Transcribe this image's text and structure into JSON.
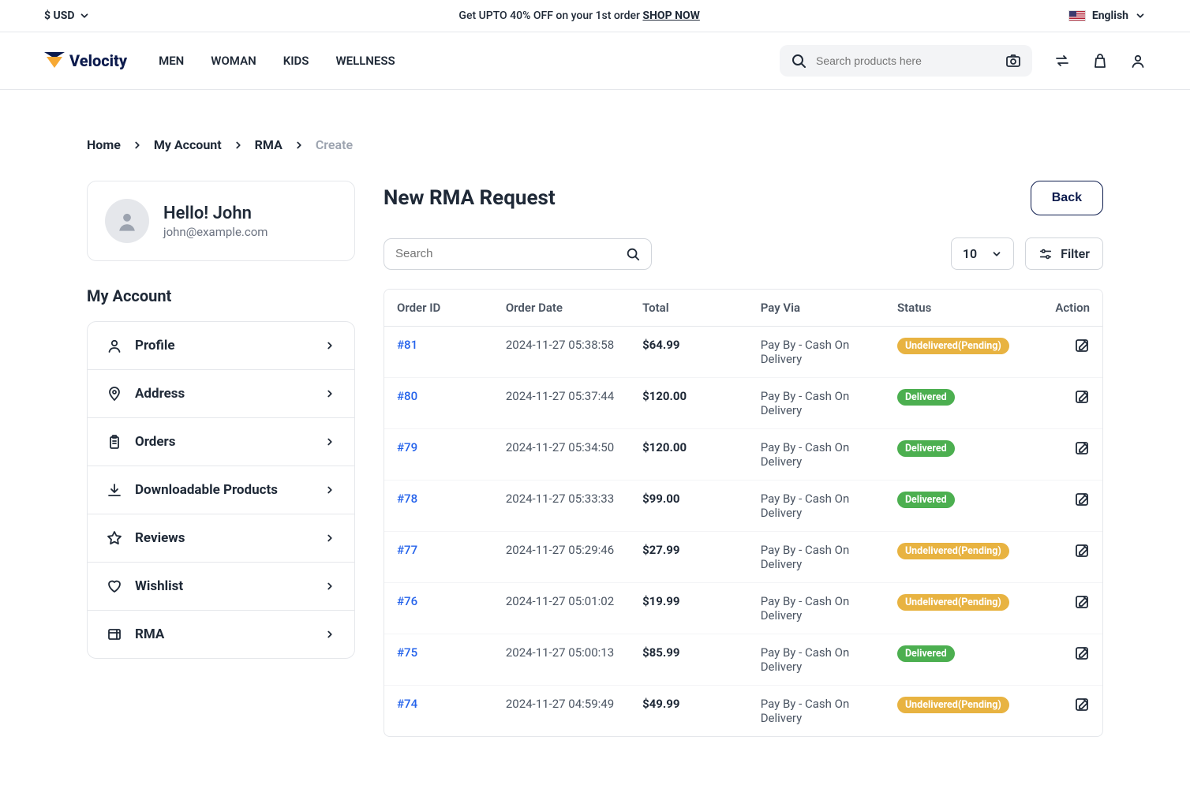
{
  "topbar": {
    "currency": "$ USD",
    "promo_prefix": "Get UPTO 40% OFF on your 1st order ",
    "promo_link": "SHOP NOW",
    "language": "English"
  },
  "header": {
    "logo_text": "Velocity",
    "nav": [
      "MEN",
      "WOMAN",
      "KIDS",
      "WELLNESS"
    ],
    "search_placeholder": "Search products here"
  },
  "breadcrumb": {
    "items": [
      "Home",
      "My Account",
      "RMA"
    ],
    "current": "Create"
  },
  "user": {
    "greeting": "Hello! John",
    "email": "john@example.com"
  },
  "sidebar": {
    "title": "My Account",
    "items": [
      {
        "label": "Profile",
        "icon": "user"
      },
      {
        "label": "Address",
        "icon": "pin"
      },
      {
        "label": "Orders",
        "icon": "clipboard"
      },
      {
        "label": "Downloadable Products",
        "icon": "download"
      },
      {
        "label": "Reviews",
        "icon": "star"
      },
      {
        "label": "Wishlist",
        "icon": "heart"
      },
      {
        "label": "RMA",
        "icon": "rma"
      }
    ]
  },
  "main": {
    "title": "New RMA Request",
    "back_label": "Back",
    "search_placeholder": "Search",
    "per_page": "10",
    "filter_label": "Filter",
    "columns": {
      "order_id": "Order ID",
      "order_date": "Order Date",
      "total": "Total",
      "pay_via": "Pay Via",
      "status": "Status",
      "action": "Action"
    },
    "rows": [
      {
        "order_id": "#81",
        "order_date": "2024-11-27 05:38:58",
        "total": "$64.99",
        "pay_via": "Pay By - Cash On Delivery",
        "status": "Undelivered(Pending)",
        "status_color": "yellow"
      },
      {
        "order_id": "#80",
        "order_date": "2024-11-27 05:37:44",
        "total": "$120.00",
        "pay_via": "Pay By - Cash On Delivery",
        "status": "Delivered",
        "status_color": "green"
      },
      {
        "order_id": "#79",
        "order_date": "2024-11-27 05:34:50",
        "total": "$120.00",
        "pay_via": "Pay By - Cash On Delivery",
        "status": "Delivered",
        "status_color": "green"
      },
      {
        "order_id": "#78",
        "order_date": "2024-11-27 05:33:33",
        "total": "$99.00",
        "pay_via": "Pay By - Cash On Delivery",
        "status": "Delivered",
        "status_color": "green"
      },
      {
        "order_id": "#77",
        "order_date": "2024-11-27 05:29:46",
        "total": "$27.99",
        "pay_via": "Pay By - Cash On Delivery",
        "status": "Undelivered(Pending)",
        "status_color": "yellow"
      },
      {
        "order_id": "#76",
        "order_date": "2024-11-27 05:01:02",
        "total": "$19.99",
        "pay_via": "Pay By - Cash On Delivery",
        "status": "Undelivered(Pending)",
        "status_color": "yellow"
      },
      {
        "order_id": "#75",
        "order_date": "2024-11-27 05:00:13",
        "total": "$85.99",
        "pay_via": "Pay By - Cash On Delivery",
        "status": "Delivered",
        "status_color": "green"
      },
      {
        "order_id": "#74",
        "order_date": "2024-11-27 04:59:49",
        "total": "$49.99",
        "pay_via": "Pay By - Cash On Delivery",
        "status": "Undelivered(Pending)",
        "status_color": "yellow"
      }
    ]
  }
}
